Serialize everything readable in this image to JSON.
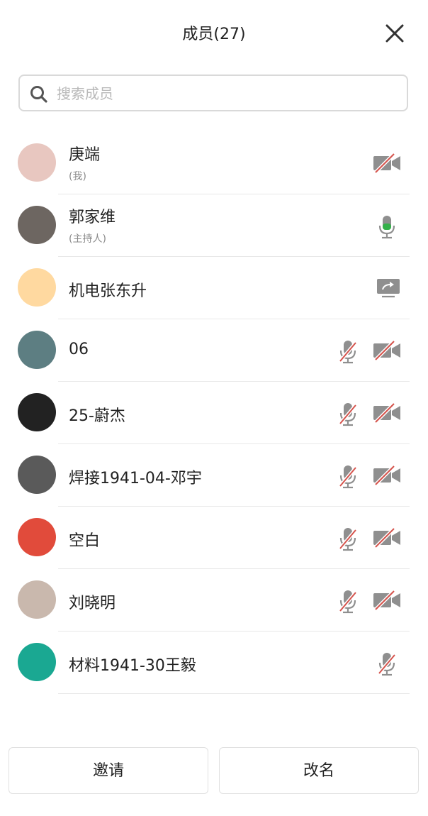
{
  "header": {
    "title": "成员(27)"
  },
  "search": {
    "placeholder": "搜索成员"
  },
  "members": [
    {
      "name": "庚端",
      "sub": "(我)",
      "status": "camera-off",
      "avatar_color": "#e8c7c0"
    },
    {
      "name": "郭家维",
      "sub": "(主持人)",
      "status": "mic-on",
      "avatar_color": "#6d6661"
    },
    {
      "name": "机电张东升",
      "sub": "",
      "status": "screen-share",
      "avatar_color": "#ffd9a0"
    },
    {
      "name": "06",
      "sub": "",
      "status": "mic-off-camera-off",
      "avatar_color": "#5d7e82"
    },
    {
      "name": "25-蔚杰",
      "sub": "",
      "status": "mic-off-camera-off",
      "avatar_color": "#222222"
    },
    {
      "name": "焊接1941-04-邓宇",
      "sub": "",
      "status": "mic-off-camera-off",
      "avatar_color": "#5a5a5a"
    },
    {
      "name": "空白",
      "sub": "",
      "status": "mic-off-camera-off",
      "avatar_color": "#e14b3b"
    },
    {
      "name": "刘晓明",
      "sub": "",
      "status": "mic-off-camera-off",
      "avatar_color": "#c9b8ad"
    },
    {
      "name": "材料1941-30王毅",
      "sub": "",
      "status": "mic-off",
      "avatar_color": "#1aa892"
    }
  ],
  "footer": {
    "invite_label": "邀请",
    "rename_label": "改名"
  },
  "colors": {
    "mic_on": "#34b04a",
    "muted_slash": "#d5534c",
    "icon_gray": "#8f8f8f"
  }
}
